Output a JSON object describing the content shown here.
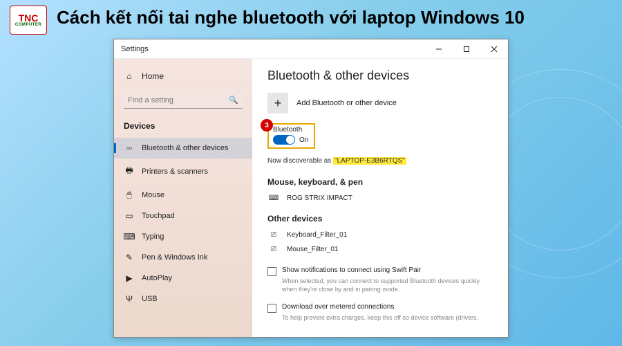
{
  "logo": {
    "text": "TNC",
    "sub": "COMPUTER"
  },
  "article_title": "Cách kết nối tai nghe bluetooth với laptop Windows 10",
  "window": {
    "title": "Settings"
  },
  "sidebar": {
    "home": "Home",
    "search_placeholder": "Find a setting",
    "section": "Devices",
    "items": [
      {
        "label": "Bluetooth & other devices",
        "icon": "bt"
      },
      {
        "label": "Printers & scanners",
        "icon": "printer"
      },
      {
        "label": "Mouse",
        "icon": "mouse"
      },
      {
        "label": "Touchpad",
        "icon": "touchpad"
      },
      {
        "label": "Typing",
        "icon": "typing"
      },
      {
        "label": "Pen & Windows Ink",
        "icon": "pen"
      },
      {
        "label": "AutoPlay",
        "icon": "autoplay"
      },
      {
        "label": "USB",
        "icon": "usb"
      }
    ]
  },
  "main": {
    "heading": "Bluetooth & other devices",
    "add_device": "Add Bluetooth or other device",
    "step_badge": "3",
    "bt_label": "Bluetooth",
    "bt_state": "On",
    "discoverable_prefix": "Now discoverable as ",
    "discoverable_name": "\"LAPTOP-E3B6RTQS\"",
    "section_mouse": "Mouse, keyboard, & pen",
    "device_mouse": "ROG STRIX IMPACT",
    "section_other": "Other devices",
    "device_other1": "Keyboard_Filter_01",
    "device_other2": "Mouse_Filter_01",
    "swift_pair": "Show notifications to connect using Swift Pair",
    "swift_pair_hint": "When selected, you can connect to supported Bluetooth devices quickly when they're close by and in pairing mode.",
    "metered": "Download over metered connections",
    "metered_hint": "To help prevent extra charges, keep this off so device software (drivers,"
  }
}
